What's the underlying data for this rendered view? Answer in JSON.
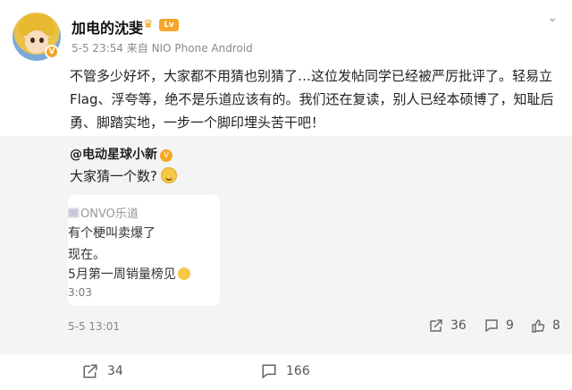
{
  "post": {
    "username": "加电的沈斐",
    "level_badge": "V",
    "meta": "5-5 23:54  来自 NIO Phone Android",
    "body": "不管多少好坏，大家都不用猜也别猜了…这位发帖同学已经被严厉批评了。轻易立Flag、浮夸等，绝不是乐道应该有的。我们还在复读，别人已经本硕博了，知耻后勇、脚踏实地，一步一个脚印埋头苦干吧！"
  },
  "repost": {
    "author": "@电动星球小新",
    "text": "大家猜一个数?",
    "card": {
      "source": "ONVO乐道",
      "line1": "有个梗叫卖爆了",
      "line2": "现在。",
      "line3": "5月第一周销量榜见",
      "time": "3:03"
    },
    "time": "5-5 13:01",
    "shares": "36",
    "comments": "9",
    "likes": "8"
  },
  "footer": {
    "shares": "34",
    "comments": "166"
  },
  "icons": [
    "share-icon",
    "comment-icon",
    "like-icon",
    "more-icon",
    "verified-icon"
  ]
}
